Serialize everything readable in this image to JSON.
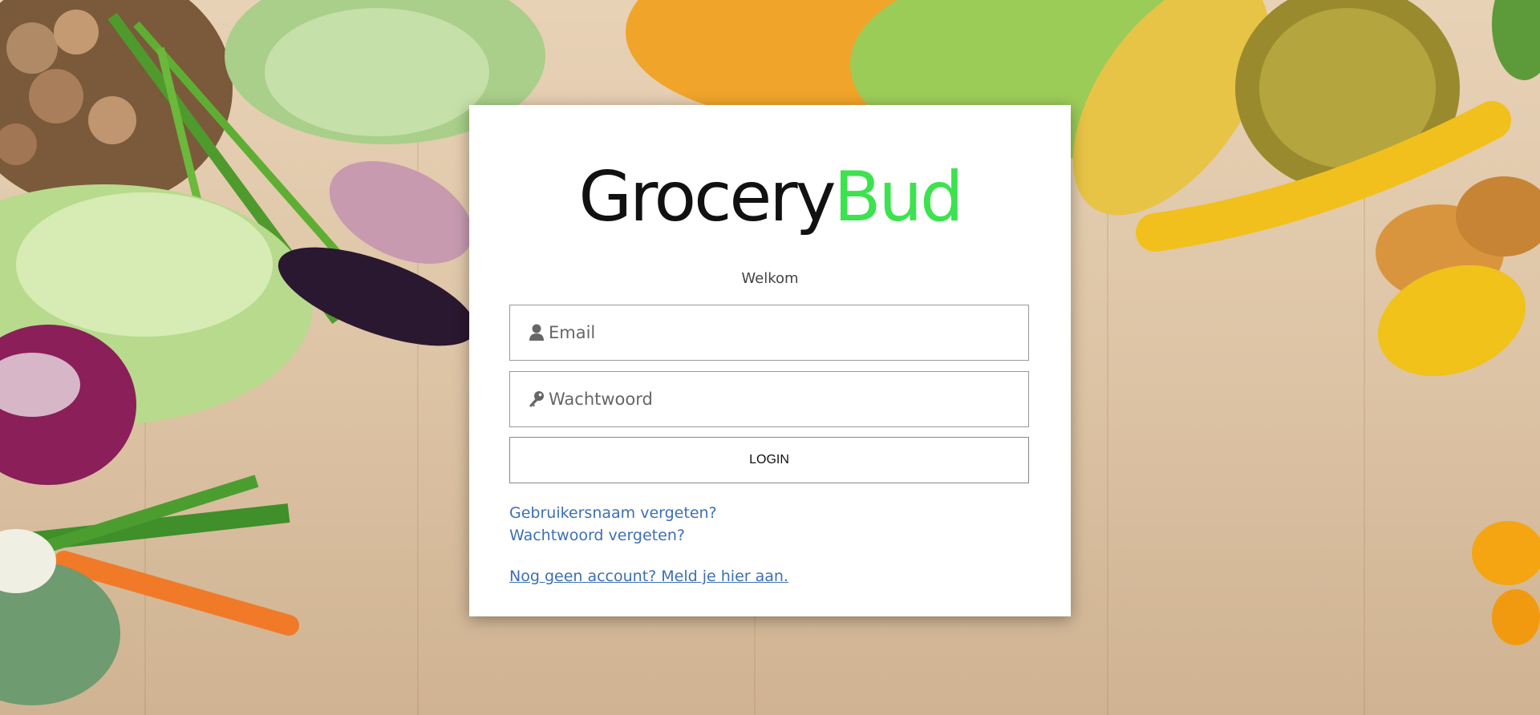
{
  "logo": {
    "part_a": "Grocery",
    "part_b": "Bud"
  },
  "welcome_text": "Welkom",
  "form": {
    "email_placeholder": "Email",
    "password_placeholder": "Wachtwoord",
    "login_label": "LOGIN"
  },
  "links": {
    "forgot_username": "Gebruikersnaam vergeten?",
    "forgot_password": "Wachtwoord vergeten?",
    "register": "Nog geen account? Meld je hier aan."
  },
  "icons": {
    "email": "user-icon",
    "password": "key-icon"
  },
  "colors": {
    "brand_green": "#3de24f",
    "link_blue": "#3d6fb5"
  }
}
